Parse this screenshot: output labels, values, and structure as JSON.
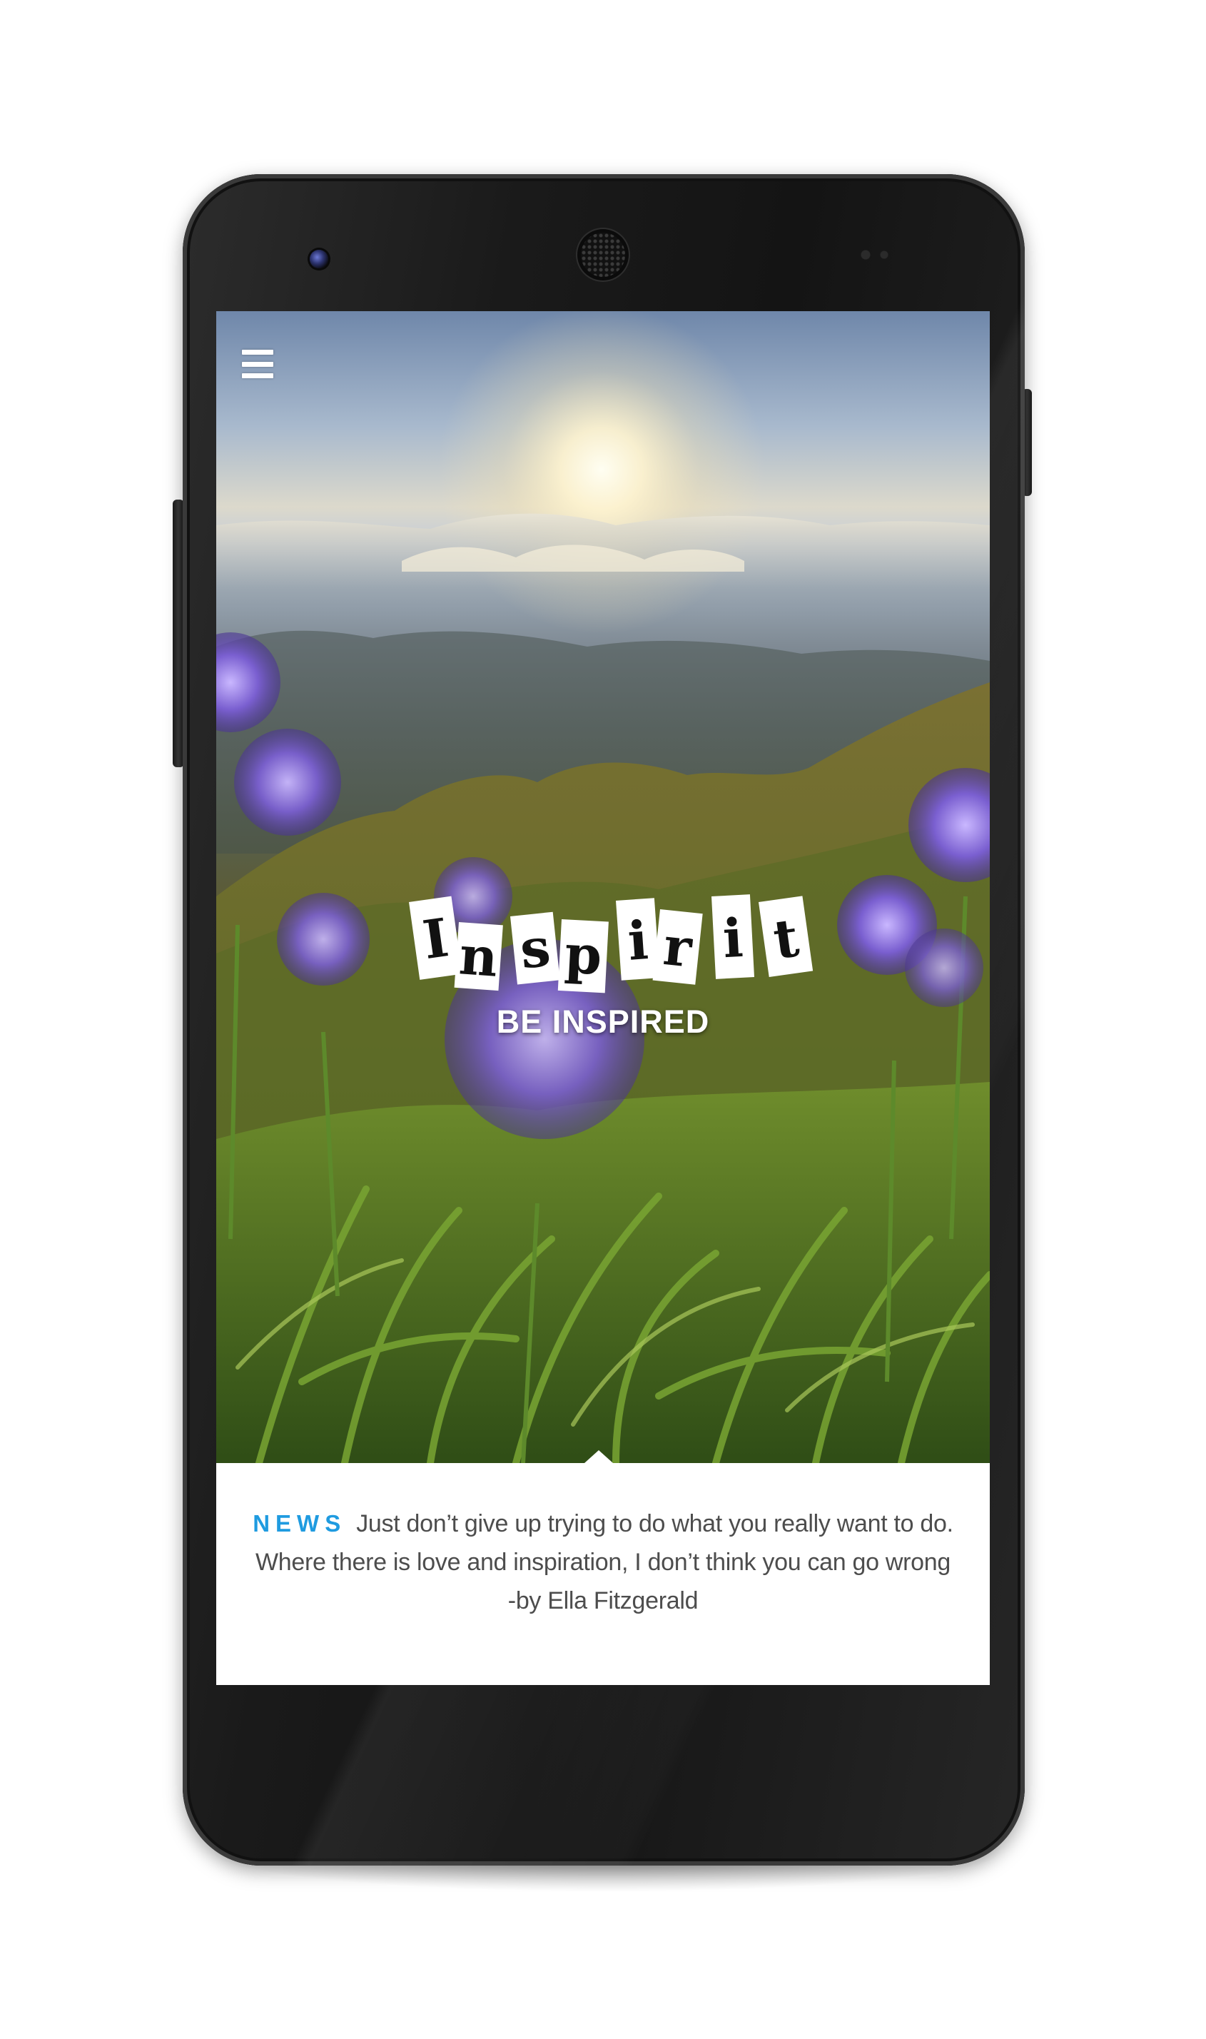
{
  "app": {
    "name": "Inspirit",
    "tagline": "BE INSPIRED",
    "logo_letters": [
      "I",
      "n",
      "s",
      "p",
      "i",
      "r",
      "i",
      "t"
    ]
  },
  "header": {
    "menu_icon": "hamburger-menu-icon"
  },
  "hero": {
    "description": "Mountain landscape at sunrise with purple agapanthus flowers"
  },
  "news": {
    "label": "NEWS",
    "text": "Just don’t give up trying to do what you really want to do. Where there is love and inspiration, I don’t think you can go wrong -by Ella Fitzgerald"
  },
  "colors": {
    "accent": "#1f9be0",
    "body_text": "#4d4d4d",
    "device": "#1a1a1a"
  }
}
